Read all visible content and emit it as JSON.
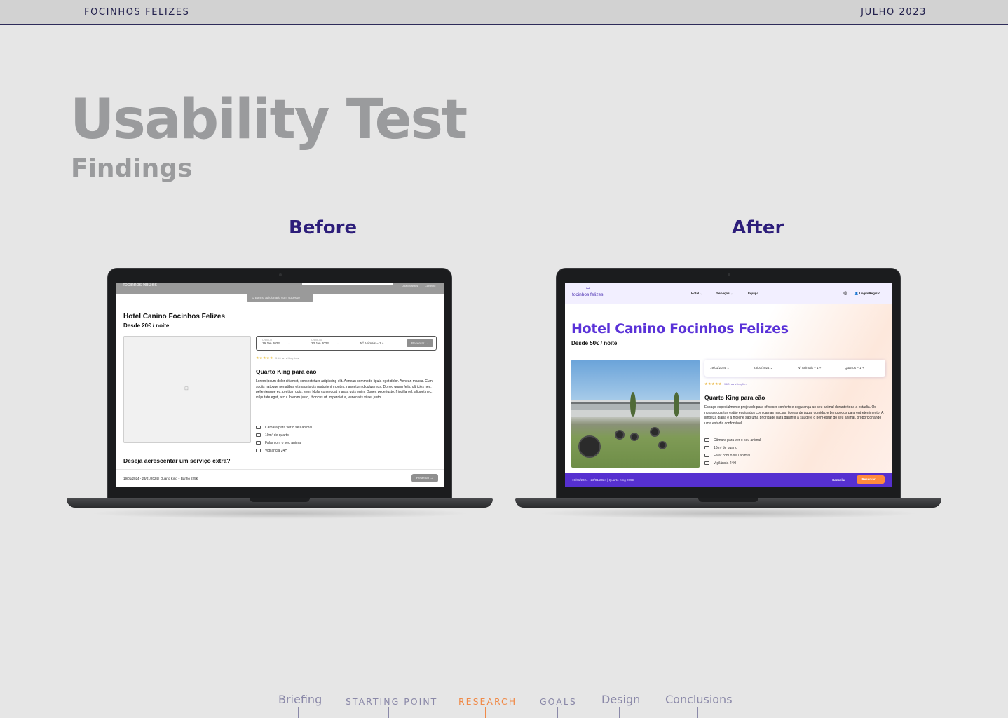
{
  "header": {
    "brand": "FOCINHOS FELIZES",
    "date": "JULHO 2023"
  },
  "title": "Usability Test",
  "subtitle": "Findings",
  "before": {
    "label": "Before",
    "nav_logo": "focinhos felizes",
    "nav_user1": "João Santos",
    "nav_user2": "Carrinho",
    "toast": "Banho adicionado com sucesso",
    "hotel_title": "Hotel Canino Focinhos Felizes",
    "price": "Desde 20€ / noite",
    "booking": {
      "checkin_label": "Check-in",
      "checkin_value": "19 Jan 2023",
      "checkout_label": "Check-out",
      "checkout_value": "23 Jan 2023",
      "animals": "Nº Animais  −  1  +",
      "reserve": "Reservar →"
    },
    "stars": "★★★★★",
    "reviews": "960 avaliações",
    "room_title": "Quarto King para cão",
    "description": "Lorem ipsum dolor sit amet, consectetuer adipiscing elit. Aenean commodo ligula eget dolor. Aenean massa. Cum sociis natoque penatibus et magnis dis parturient montes, nascetur ridiculus mus. Donec quam felis, ultricies nec, pellentesque eu, pretium quis, sem. Nulla consequat massa quis enim. Donec pede justo, fringilla vel, aliquet nec, vulputate eget, arcu. In enim justo, rhoncus ut, imperdiet a, venenatis vitae, justo.",
    "features": [
      "Câmara para ver o seu animal",
      "10m² de quarto",
      "Falar com o seu animal",
      "Vigilância 24H"
    ],
    "extra_title": "Deseja acrescentar um serviço extra?",
    "footer_summary": "19/01/2024 - 23/01/2024  |  Quarto King  +  Banho  225€",
    "footer_button": "Reservar →"
  },
  "after": {
    "label": "After",
    "nav_logo": "focinhos felizes",
    "nav_menu": [
      "Hotel ⌄",
      "Serviços ⌄",
      "Equipa"
    ],
    "login": "Login/Registo",
    "hotel_title": "Hotel Canino Focinhos Felizes",
    "price": "Desde 50€ / noite",
    "booking": {
      "checkin": "19/01/2024  ⌄",
      "checkout": "23/01/2024  ⌄",
      "animals": "Nº Animais  −  1  +",
      "rooms": "Quartos  −  1  +"
    },
    "stars": "★★★★★",
    "reviews": "960 avaliações",
    "room_title": "Quarto King para cão",
    "description": "Espaço especialmente projetado para oferecer conforto e segurança ao seu animal durante toda a estadia. Os nossos quartos estão equipados com camas macias, tigelas de água, comida, e brinquedos para entretenimento. A limpeza diária e a higiene são uma prioridade para garantir a saúde e o bem-estar do seu animal, proporcionando uma estadia confortável.",
    "features": [
      "Câmara para ver o seu animal",
      "10m² de quarto",
      "Falar com o seu animal",
      "Vigilância 24H"
    ],
    "footer_summary": "19/01/2024 - 23/01/2024  |  Quarto King  209€",
    "cancel": "Cancelar",
    "footer_button": "Reservar →"
  },
  "bottom_nav": [
    {
      "label": "Briefing",
      "active": false
    },
    {
      "label": "STARTING POINT",
      "active": false
    },
    {
      "label": "RESEARCH",
      "active": true
    },
    {
      "label": "GOALS",
      "active": false
    },
    {
      "label": "Design",
      "active": false
    },
    {
      "label": "Conclusions",
      "active": false
    }
  ],
  "colors": {
    "accent_purple": "#5630d0",
    "accent_orange": "#f08a48",
    "heading_gray": "#9a9b9d",
    "navy": "#2d1e7a"
  }
}
